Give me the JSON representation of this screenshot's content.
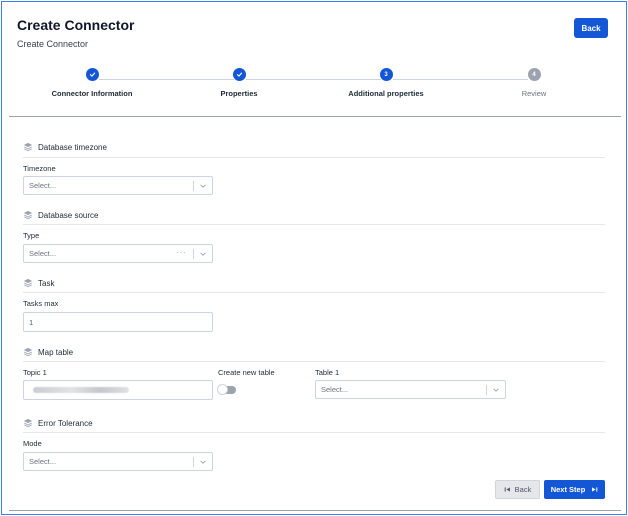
{
  "header": {
    "title": "Create Connector",
    "subtitle": "Create Connector",
    "back_label": "Back"
  },
  "stepper": {
    "steps": [
      {
        "label": "Connector Information",
        "status": "done",
        "marker": ""
      },
      {
        "label": "Properties",
        "status": "done",
        "marker": ""
      },
      {
        "label": "Additional properties",
        "status": "active",
        "marker": "3"
      },
      {
        "label": "Review",
        "status": "pending",
        "marker": "4"
      }
    ]
  },
  "sections": {
    "timezone": {
      "title": "Database timezone",
      "field_label": "Timezone",
      "select_value": "Select..."
    },
    "source": {
      "title": "Database source",
      "field_label": "Type",
      "select_value": "Select...",
      "loading_indicator": "···"
    },
    "task": {
      "title": "Task",
      "field_label": "Tasks max",
      "input_value": "1"
    },
    "map_table": {
      "title": "Map table",
      "topic_label": "Topic 1",
      "create_new_label": "Create new table",
      "create_new_on": false,
      "table_label": "Table 1",
      "table_select_value": "Select..."
    },
    "error_tolerance": {
      "title": "Error Tolerance",
      "field_label": "Mode",
      "select_value": "Select..."
    }
  },
  "footer": {
    "back_label": "Back",
    "next_label": "Next Step"
  },
  "colors": {
    "primary": "#1357d6",
    "pending": "#9ca3af",
    "frame_border": "#3b82f6"
  }
}
